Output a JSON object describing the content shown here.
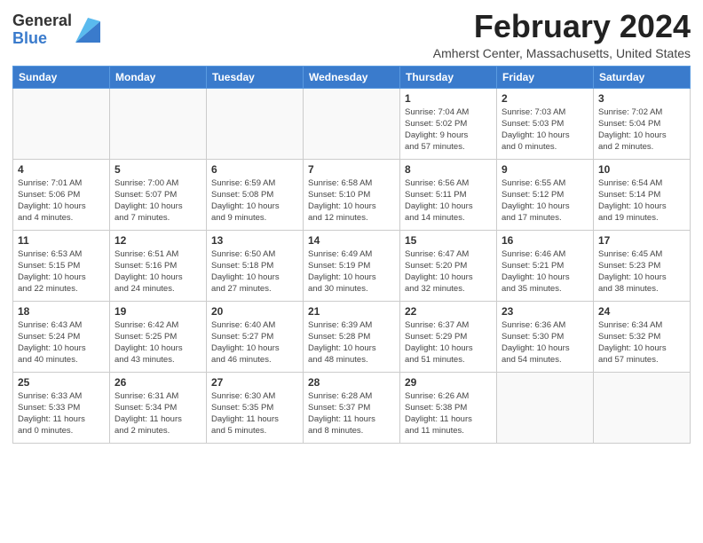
{
  "header": {
    "logo_general": "General",
    "logo_blue": "Blue",
    "month_title": "February 2024",
    "location": "Amherst Center, Massachusetts, United States"
  },
  "weekdays": [
    "Sunday",
    "Monday",
    "Tuesday",
    "Wednesday",
    "Thursday",
    "Friday",
    "Saturday"
  ],
  "weeks": [
    [
      {
        "day": "",
        "info": ""
      },
      {
        "day": "",
        "info": ""
      },
      {
        "day": "",
        "info": ""
      },
      {
        "day": "",
        "info": ""
      },
      {
        "day": "1",
        "info": "Sunrise: 7:04 AM\nSunset: 5:02 PM\nDaylight: 9 hours\nand 57 minutes."
      },
      {
        "day": "2",
        "info": "Sunrise: 7:03 AM\nSunset: 5:03 PM\nDaylight: 10 hours\nand 0 minutes."
      },
      {
        "day": "3",
        "info": "Sunrise: 7:02 AM\nSunset: 5:04 PM\nDaylight: 10 hours\nand 2 minutes."
      }
    ],
    [
      {
        "day": "4",
        "info": "Sunrise: 7:01 AM\nSunset: 5:06 PM\nDaylight: 10 hours\nand 4 minutes."
      },
      {
        "day": "5",
        "info": "Sunrise: 7:00 AM\nSunset: 5:07 PM\nDaylight: 10 hours\nand 7 minutes."
      },
      {
        "day": "6",
        "info": "Sunrise: 6:59 AM\nSunset: 5:08 PM\nDaylight: 10 hours\nand 9 minutes."
      },
      {
        "day": "7",
        "info": "Sunrise: 6:58 AM\nSunset: 5:10 PM\nDaylight: 10 hours\nand 12 minutes."
      },
      {
        "day": "8",
        "info": "Sunrise: 6:56 AM\nSunset: 5:11 PM\nDaylight: 10 hours\nand 14 minutes."
      },
      {
        "day": "9",
        "info": "Sunrise: 6:55 AM\nSunset: 5:12 PM\nDaylight: 10 hours\nand 17 minutes."
      },
      {
        "day": "10",
        "info": "Sunrise: 6:54 AM\nSunset: 5:14 PM\nDaylight: 10 hours\nand 19 minutes."
      }
    ],
    [
      {
        "day": "11",
        "info": "Sunrise: 6:53 AM\nSunset: 5:15 PM\nDaylight: 10 hours\nand 22 minutes."
      },
      {
        "day": "12",
        "info": "Sunrise: 6:51 AM\nSunset: 5:16 PM\nDaylight: 10 hours\nand 24 minutes."
      },
      {
        "day": "13",
        "info": "Sunrise: 6:50 AM\nSunset: 5:18 PM\nDaylight: 10 hours\nand 27 minutes."
      },
      {
        "day": "14",
        "info": "Sunrise: 6:49 AM\nSunset: 5:19 PM\nDaylight: 10 hours\nand 30 minutes."
      },
      {
        "day": "15",
        "info": "Sunrise: 6:47 AM\nSunset: 5:20 PM\nDaylight: 10 hours\nand 32 minutes."
      },
      {
        "day": "16",
        "info": "Sunrise: 6:46 AM\nSunset: 5:21 PM\nDaylight: 10 hours\nand 35 minutes."
      },
      {
        "day": "17",
        "info": "Sunrise: 6:45 AM\nSunset: 5:23 PM\nDaylight: 10 hours\nand 38 minutes."
      }
    ],
    [
      {
        "day": "18",
        "info": "Sunrise: 6:43 AM\nSunset: 5:24 PM\nDaylight: 10 hours\nand 40 minutes."
      },
      {
        "day": "19",
        "info": "Sunrise: 6:42 AM\nSunset: 5:25 PM\nDaylight: 10 hours\nand 43 minutes."
      },
      {
        "day": "20",
        "info": "Sunrise: 6:40 AM\nSunset: 5:27 PM\nDaylight: 10 hours\nand 46 minutes."
      },
      {
        "day": "21",
        "info": "Sunrise: 6:39 AM\nSunset: 5:28 PM\nDaylight: 10 hours\nand 48 minutes."
      },
      {
        "day": "22",
        "info": "Sunrise: 6:37 AM\nSunset: 5:29 PM\nDaylight: 10 hours\nand 51 minutes."
      },
      {
        "day": "23",
        "info": "Sunrise: 6:36 AM\nSunset: 5:30 PM\nDaylight: 10 hours\nand 54 minutes."
      },
      {
        "day": "24",
        "info": "Sunrise: 6:34 AM\nSunset: 5:32 PM\nDaylight: 10 hours\nand 57 minutes."
      }
    ],
    [
      {
        "day": "25",
        "info": "Sunrise: 6:33 AM\nSunset: 5:33 PM\nDaylight: 11 hours\nand 0 minutes."
      },
      {
        "day": "26",
        "info": "Sunrise: 6:31 AM\nSunset: 5:34 PM\nDaylight: 11 hours\nand 2 minutes."
      },
      {
        "day": "27",
        "info": "Sunrise: 6:30 AM\nSunset: 5:35 PM\nDaylight: 11 hours\nand 5 minutes."
      },
      {
        "day": "28",
        "info": "Sunrise: 6:28 AM\nSunset: 5:37 PM\nDaylight: 11 hours\nand 8 minutes."
      },
      {
        "day": "29",
        "info": "Sunrise: 6:26 AM\nSunset: 5:38 PM\nDaylight: 11 hours\nand 11 minutes."
      },
      {
        "day": "",
        "info": ""
      },
      {
        "day": "",
        "info": ""
      }
    ]
  ]
}
